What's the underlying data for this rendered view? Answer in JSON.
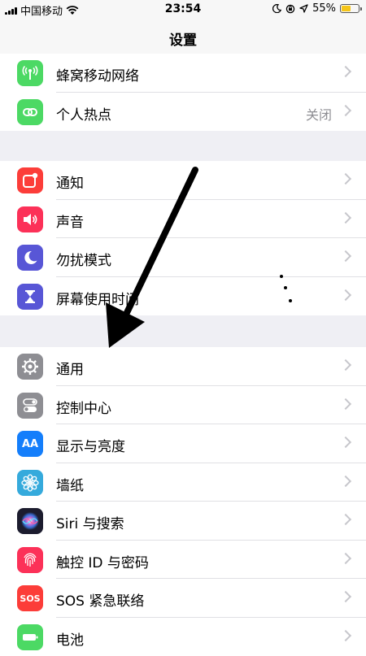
{
  "status": {
    "carrier": "中国移动",
    "time": "23:54",
    "battery": "55%",
    "battery_level": 0.55
  },
  "nav": {
    "title": "设置"
  },
  "groups": [
    {
      "items": [
        {
          "label": "蜂窝移动网络",
          "icon": "cellular-antenna-icon",
          "color": "#4cd964"
        },
        {
          "label": "个人热点",
          "value": "关闭",
          "icon": "hotspot-link-icon",
          "color": "#4cd964"
        }
      ]
    },
    {
      "items": [
        {
          "label": "通知",
          "icon": "notification-icon",
          "color": "#fc3d39"
        },
        {
          "label": "声音",
          "icon": "speaker-icon",
          "color": "#fc3158"
        },
        {
          "label": "勿扰模式",
          "icon": "moon-icon",
          "color": "#5856d6"
        },
        {
          "label": "屏幕使用时间",
          "icon": "hourglass-icon",
          "color": "#5856d6"
        }
      ]
    },
    {
      "items": [
        {
          "label": "通用",
          "icon": "gear-icon",
          "color": "#8e8e93"
        },
        {
          "label": "控制中心",
          "icon": "toggles-icon",
          "color": "#8e8e93"
        },
        {
          "label": "显示与亮度",
          "icon": "text-size-icon",
          "icon_text": "AA",
          "color": "#147efb"
        },
        {
          "label": "墙纸",
          "icon": "flower-icon",
          "color": "#35aadc"
        },
        {
          "label": "Siri 与搜索",
          "icon": "siri-icon",
          "color": "#1c1c2e"
        },
        {
          "label": "触控 ID 与密码",
          "icon": "fingerprint-icon",
          "color": "#fc3158"
        },
        {
          "label": "SOS 紧急联络",
          "icon": "sos-icon",
          "icon_text": "SOS",
          "color": "#fc3d39"
        },
        {
          "label": "电池",
          "icon": "battery-icon",
          "color": "#4cd964"
        }
      ]
    }
  ]
}
